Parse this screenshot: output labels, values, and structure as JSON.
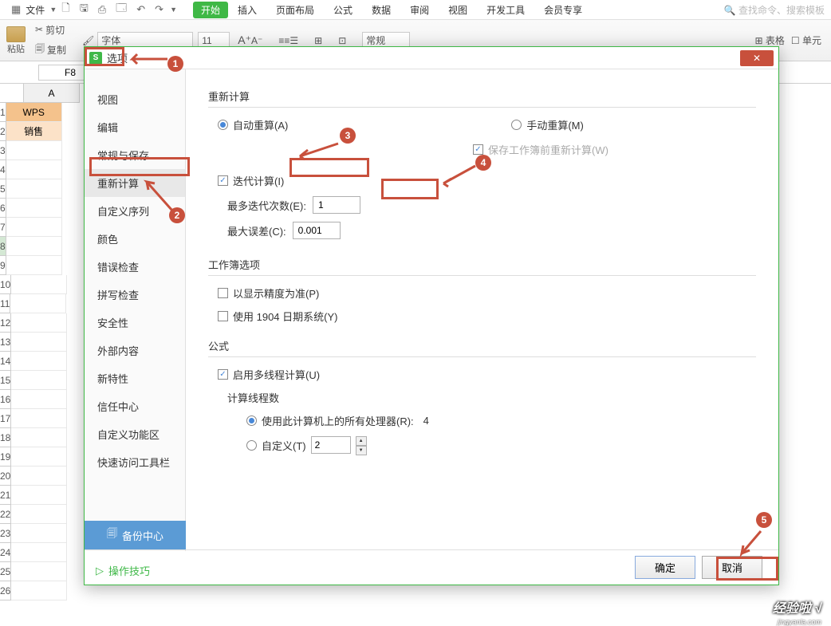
{
  "ribbon": {
    "file": "文件",
    "tabs": [
      "开始",
      "插入",
      "页面布局",
      "公式",
      "数据",
      "审阅",
      "视图",
      "开发工具",
      "会员专享"
    ],
    "active_tab": "开始",
    "search_placeholder": "查找命令、搜索模板"
  },
  "toolbar": {
    "paste": "粘贴",
    "cut": "剪切",
    "copy": "复制",
    "font_label": "字体",
    "font_size": "11",
    "combo": "常规",
    "tablestyle": "表格",
    "cellstyle": "单元"
  },
  "formula_bar": {
    "cell_ref": "F8"
  },
  "sheet": {
    "col_a": "A",
    "row1_a": "WPS",
    "row2_a": "销售"
  },
  "dialog": {
    "title": "选项",
    "sidebar_items": [
      "视图",
      "编辑",
      "常规与保存",
      "重新计算",
      "自定义序列",
      "颜色",
      "错误检查",
      "拼写检查",
      "安全性",
      "外部内容",
      "新特性",
      "信任中心",
      "自定义功能区",
      "快速访问工具栏"
    ],
    "active_item": "重新计算",
    "backup_center": "备份中心",
    "tips": "操作技巧",
    "sections": {
      "recalc": {
        "title": "重新计算",
        "auto": "自动重算(A)",
        "manual": "手动重算(M)",
        "save_before": "保存工作簿前重新计算(W)",
        "iterative": "迭代计算(I)",
        "max_iter_label": "最多迭代次数(E):",
        "max_iter_value": "1",
        "max_change_label": "最大误差(C):",
        "max_change_value": "0.001"
      },
      "workbook": {
        "title": "工作簿选项",
        "precision": "以显示精度为准(P)",
        "date1904": "使用 1904 日期系统(Y)"
      },
      "formula": {
        "title": "公式",
        "multithread": "启用多线程计算(U)",
        "thread_count": "计算线程数",
        "use_all": "使用此计算机上的所有处理器(R):",
        "processor_count": "4",
        "custom": "自定义(T)",
        "custom_value": "2"
      }
    },
    "ok": "确定",
    "cancel": "取消"
  },
  "watermark": {
    "main": "经验啦 √",
    "sub": "jingyanla.com"
  }
}
